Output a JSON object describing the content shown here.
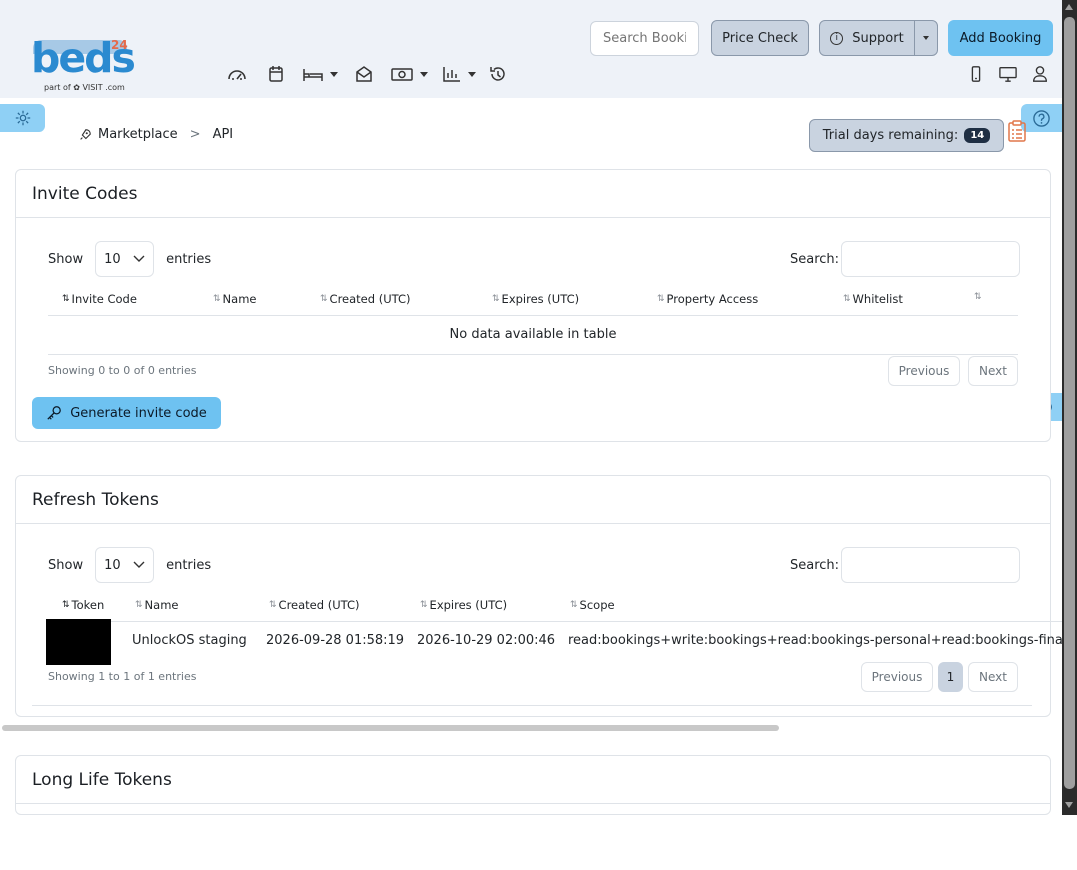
{
  "brand": {
    "name": "beds",
    "superscript": "24",
    "tagline": "part of ✿ VISIT .com"
  },
  "header": {
    "search_placeholder": "Search Booking",
    "price_check_label": "Price Check",
    "support_label": "Support",
    "add_booking_label": "Add Booking"
  },
  "nav_icons": [
    "dashboard-icon",
    "calendar-icon",
    "bed-icon",
    "inbox-icon",
    "money-icon",
    "chart-icon",
    "history-icon"
  ],
  "breadcrumb": {
    "items": [
      "Marketplace",
      "API"
    ],
    "separator": ">"
  },
  "trial": {
    "label": "Trial days remaining:",
    "days": "14"
  },
  "invite_codes": {
    "title": "Invite Codes",
    "show_label": "Show",
    "page_size": "10",
    "entries_label": "entries",
    "search_label": "Search:",
    "columns": [
      "Invite Code",
      "Name",
      "Created (UTC)",
      "Expires (UTC)",
      "Property Access",
      "Whitelist",
      ""
    ],
    "empty_message": "No data available in table",
    "info": "Showing 0 to 0 of 0 entries",
    "previous": "Previous",
    "next": "Next",
    "generate_label": "Generate invite code"
  },
  "refresh_tokens": {
    "title": "Refresh Tokens",
    "show_label": "Show",
    "page_size": "10",
    "entries_label": "entries",
    "search_label": "Search:",
    "columns": [
      "Token",
      "Name",
      "Created (UTC)",
      "Expires (UTC)",
      "Scope"
    ],
    "rows": [
      {
        "token": "",
        "name": "UnlockOS staging",
        "created": "2026-09-28 01:58:19",
        "expires": "2026-10-29 02:00:46",
        "scope": "read:bookings+write:bookings+read:bookings-personal+read:bookings-financia"
      }
    ],
    "info": "Showing 1 to 1 of 1 entries",
    "previous": "Previous",
    "page": "1",
    "next": "Next"
  },
  "long_life_tokens": {
    "title": "Long Life Tokens"
  }
}
